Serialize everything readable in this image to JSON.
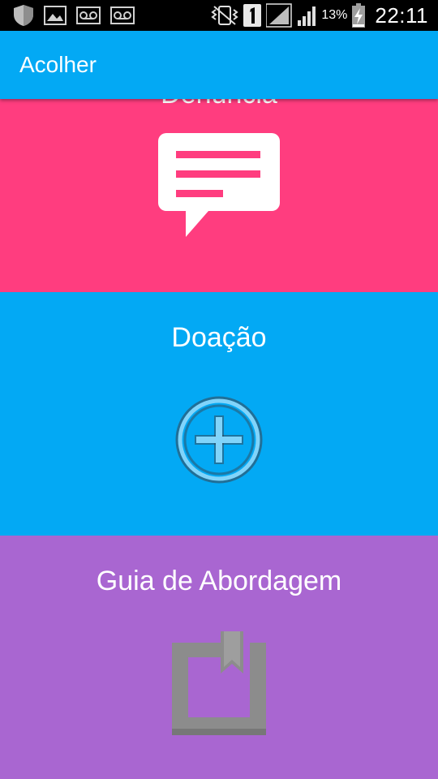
{
  "status_bar": {
    "icons": [
      "shield-icon",
      "image-icon",
      "voicemail-icon",
      "voicemail-icon",
      "vibrate-icon",
      "sim-1-icon",
      "signal-icon",
      "signal-icon",
      "battery-charging-icon"
    ],
    "battery_percent": "13%",
    "time": "22:11"
  },
  "app_bar": {
    "title": "Acolher",
    "color": "#03A9F4"
  },
  "cards": [
    {
      "label": "Denúncia",
      "icon": "message-icon",
      "color": "#FF3D7F"
    },
    {
      "label": "Doação",
      "icon": "add-circle-icon",
      "color": "#03A9F4"
    },
    {
      "label": "Guia de Abordagem",
      "icon": "bookmark-book-icon",
      "color": "#A966D1"
    }
  ]
}
